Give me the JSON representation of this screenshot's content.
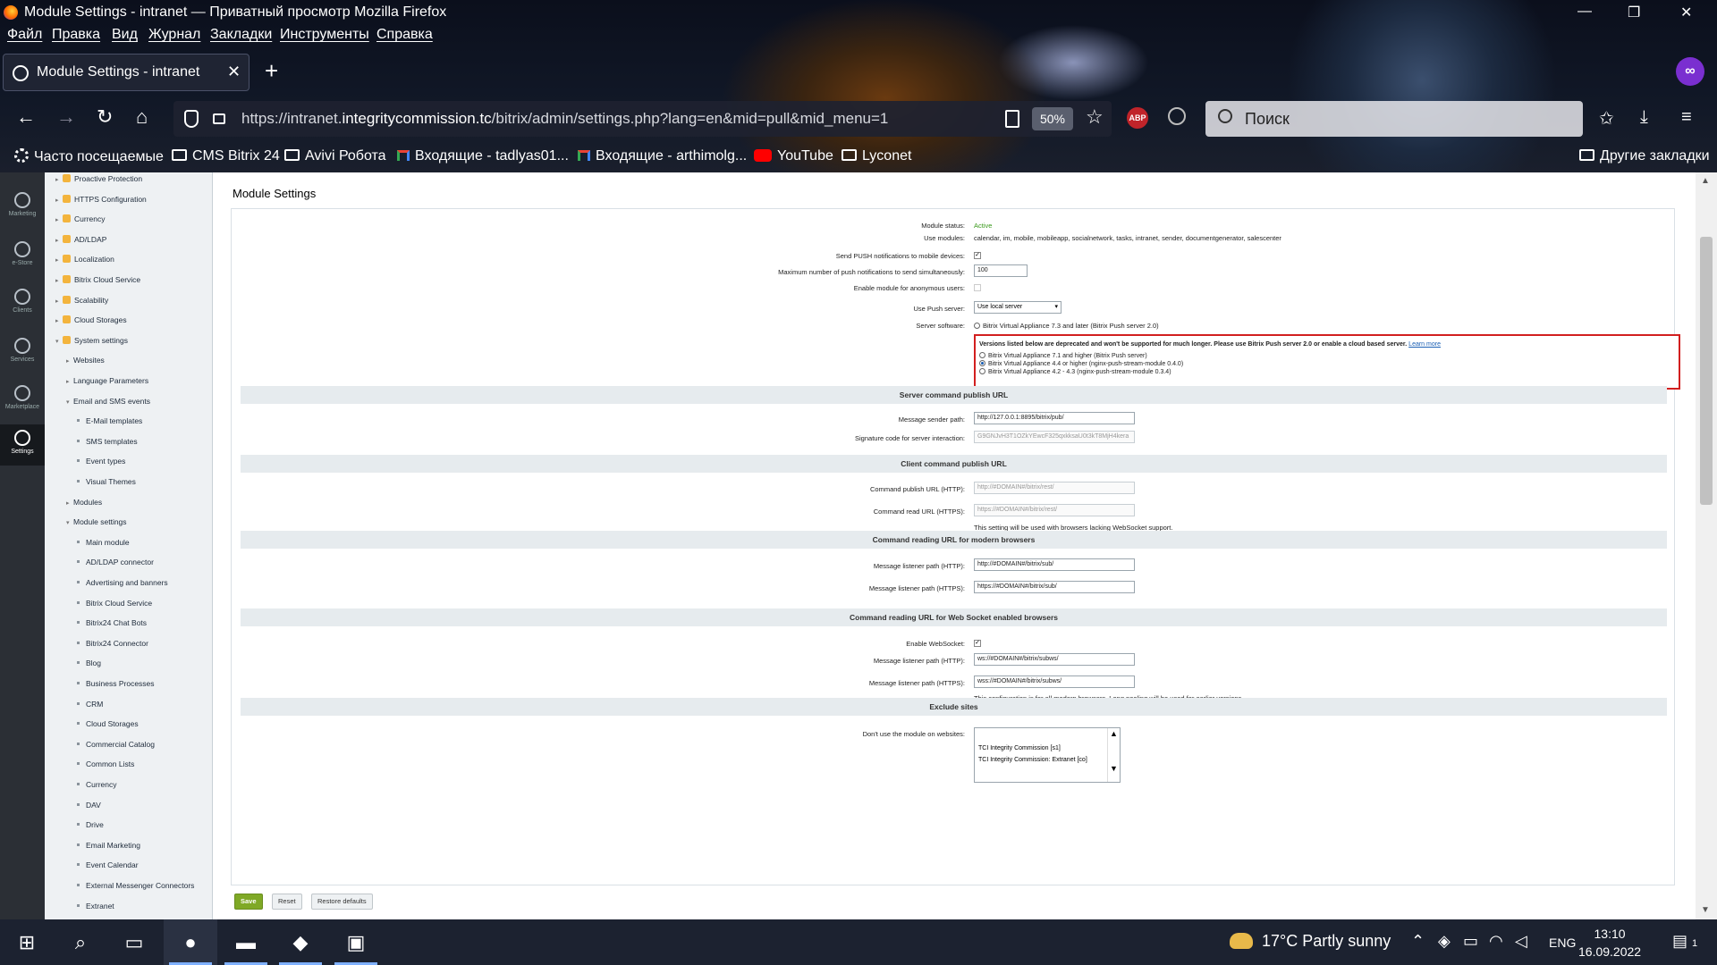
{
  "window": {
    "title": "Module Settings - intranet — Приватный просмотр Mozilla Firefox",
    "controls": {
      "minimize": "—",
      "maximize": "❐",
      "close": "✕"
    }
  },
  "menu": [
    "Файл",
    "Правка",
    "Вид",
    "Журнал",
    "Закладки",
    "Инструменты",
    "Справка"
  ],
  "tab": {
    "title": "Module Settings - intranet",
    "close": "✕",
    "new": "+"
  },
  "nav": {
    "back": "←",
    "forward": "→",
    "reload": "↻",
    "home": "⌂"
  },
  "urlbar": {
    "prefix": "https://intranet.",
    "domain": "integritycommission.tc",
    "path": "/bitrix/admin/settings.php?lang=en&mid=pull&mid_menu=1",
    "zoom": "50%",
    "star": "☆"
  },
  "extensions": {
    "abp": "ABP",
    "mask": "∞"
  },
  "search": {
    "placeholder": "Поиск"
  },
  "toolbar_right": {
    "pocket": "✩",
    "downloads": "⤓",
    "menu": "≡"
  },
  "bookmarks": [
    "Часто посещаемые",
    "CMS Bitrix 24",
    "Avivi Робота",
    "Входящие - tadlyas01...",
    "Входящие - arthimolg...",
    "YouTube",
    "Lyconet"
  ],
  "bookmarks_other": "Другие закладки",
  "leftbar": [
    {
      "label": "Marketing"
    },
    {
      "label": "e-Store"
    },
    {
      "label": "Clients"
    },
    {
      "label": "Services"
    },
    {
      "label": "Marketplace"
    },
    {
      "label": "Settings"
    }
  ],
  "tree": [
    {
      "label": "Proactive Protection",
      "lvl": 0
    },
    {
      "label": "HTTPS Configuration",
      "lvl": 0
    },
    {
      "label": "Currency",
      "lvl": 0
    },
    {
      "label": "AD/LDAP",
      "lvl": 0
    },
    {
      "label": "Localization",
      "lvl": 0
    },
    {
      "label": "Bitrix Cloud Service",
      "lvl": 0
    },
    {
      "label": "Scalability",
      "lvl": 0
    },
    {
      "label": "Cloud Storages",
      "lvl": 0
    },
    {
      "label": "System settings",
      "lvl": 0,
      "open": true
    },
    {
      "label": "Websites",
      "lvl": 1
    },
    {
      "label": "Language Parameters",
      "lvl": 1
    },
    {
      "label": "Email and SMS events",
      "lvl": 1,
      "open": true
    },
    {
      "label": "E-Mail templates",
      "lvl": 2
    },
    {
      "label": "SMS templates",
      "lvl": 2
    },
    {
      "label": "Event types",
      "lvl": 2
    },
    {
      "label": "Visual Themes",
      "lvl": 2
    },
    {
      "label": "Modules",
      "lvl": 1,
      "leaf": true
    },
    {
      "label": "Module settings",
      "lvl": 1,
      "open": true
    },
    {
      "label": "Main module",
      "lvl": 2
    },
    {
      "label": "AD/LDAP connector",
      "lvl": 2
    },
    {
      "label": "Advertising and banners",
      "lvl": 2
    },
    {
      "label": "Bitrix Cloud Service",
      "lvl": 2
    },
    {
      "label": "Bitrix24 Chat Bots",
      "lvl": 2
    },
    {
      "label": "Bitrix24 Connector",
      "lvl": 2
    },
    {
      "label": "Blog",
      "lvl": 2
    },
    {
      "label": "Business Processes",
      "lvl": 2
    },
    {
      "label": "CRM",
      "lvl": 2
    },
    {
      "label": "Cloud Storages",
      "lvl": 2
    },
    {
      "label": "Commercial Catalog",
      "lvl": 2
    },
    {
      "label": "Common Lists",
      "lvl": 2
    },
    {
      "label": "Currency",
      "lvl": 2
    },
    {
      "label": "DAV",
      "lvl": 2
    },
    {
      "label": "Drive",
      "lvl": 2
    },
    {
      "label": "Email Marketing",
      "lvl": 2
    },
    {
      "label": "Event Calendar",
      "lvl": 2
    },
    {
      "label": "External Messenger Connectors",
      "lvl": 2
    },
    {
      "label": "Extranet",
      "lvl": 2
    }
  ],
  "page": {
    "title": "Module Settings"
  },
  "form": {
    "status_label": "Module status:",
    "status_value": "Active",
    "uses_label": "Use modules:",
    "uses_value": "calendar, im, mobile, mobileapp, socialnetwork, tasks, intranet, sender, documentgenerator, salescenter",
    "push_label": "Send PUSH notifications to mobile devices:",
    "push_checked": "✓",
    "max_label": "Maximum number of push notifications to send simultaneously:",
    "max_value": "100",
    "anon_label": "Enable module for anonymous users:",
    "server_label": "Use Push server:",
    "server_value": "Use local server",
    "software_label": "Server software:",
    "software_opt1": "Bitrix Virtual Appliance 7.3 and later (Bitrix Push server 2.0)",
    "warn_text": "Versions listed below are deprecated and won't be supported for much longer. Please use Bitrix Push server 2.0 or enable a cloud based server.",
    "warn_link": "Learn more",
    "warn_opts": [
      "Bitrix Virtual Appliance 7.1 and higher (Bitrix Push server)",
      "Bitrix Virtual Appliance 4.4 or higher (nginx-push-stream-module 0.4.0)",
      "Bitrix Virtual Appliance 4.2 - 4.3 (nginx-push-stream-module 0.3.4)"
    ],
    "sec1": "Server command publish URL",
    "sender_label": "Message sender path:",
    "sender_value": "http://127.0.0.1:8895/bitrix/pub/",
    "sig_label": "Signature code for server interaction:",
    "sig_value": "G9GNJvH3T1OZkYEwcF325qxkksaU0t3kT8MjH4kera",
    "sec2": "Client command publish URL",
    "cp_http_label": "Command publish URL (HTTP):",
    "cp_http_value": "http://#DOMAIN#/bitrix/rest/",
    "cr_https_label": "Command read URL (HTTPS):",
    "cr_https_value": "https://#DOMAIN#/bitrix/rest/",
    "ws_note": "This setting will be used with browsers lacking WebSocket support.",
    "sec3": "Command reading URL for modern browsers",
    "ml_http_label": "Message listener path (HTTP):",
    "ml_http_value": "http://#DOMAIN#/bitrix/sub/",
    "ml_https_label": "Message listener path (HTTPS):",
    "ml_https_value": "https://#DOMAIN#/bitrix/sub/",
    "sec4": "Command reading URL for Web Socket enabled browsers",
    "ews_label": "Enable WebSocket:",
    "ews_checked": "✓",
    "wl_http_label": "Message listener path (HTTP):",
    "wl_http_value": "ws://#DOMAIN#/bitrix/subws/",
    "wl_https_label": "Message listener path (HTTPS):",
    "wl_https_value": "wss://#DOMAIN#/bitrix/subws/",
    "modern_note": "This configuration is for all modern browsers. Long pooling will be used for earlier versions.",
    "sec5": "Exclude sites",
    "exclude_label": "Don't use the module on websites:",
    "sites": [
      "TCI Integrity Commission [s1]",
      "TCI Integrity Commission: Extranet [co]"
    ]
  },
  "buttons": {
    "save": "Save",
    "reset": "Reset",
    "restore": "Restore defaults"
  },
  "taskbar": {
    "weather": "17°C  Partly sunny",
    "lang": "ENG",
    "time": "13:10",
    "date": "16.09.2022",
    "notif": "1"
  }
}
